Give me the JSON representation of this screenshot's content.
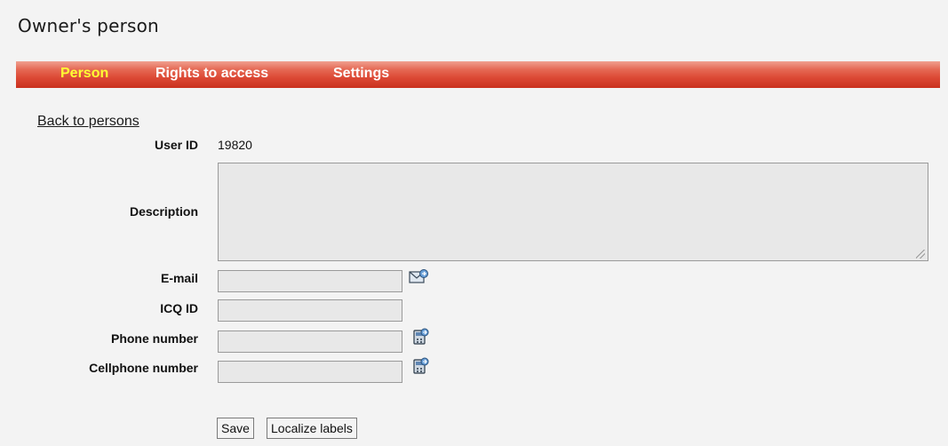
{
  "page": {
    "title": "Owner's person"
  },
  "tabs": [
    {
      "label": "Person",
      "active": true
    },
    {
      "label": "Rights to access",
      "active": false
    },
    {
      "label": "Settings",
      "active": false
    }
  ],
  "back_link": "Back to persons",
  "form": {
    "user_id": {
      "label": "User ID",
      "value": "19820"
    },
    "description": {
      "label": "Description",
      "value": ""
    },
    "email": {
      "label": "E-mail",
      "value": "",
      "icon": "email-send-icon"
    },
    "icq": {
      "label": "ICQ ID",
      "value": ""
    },
    "phone": {
      "label": "Phone number",
      "value": "",
      "icon": "phone-call-icon"
    },
    "cellphone": {
      "label": "Cellphone number",
      "value": "",
      "icon": "phone-call-icon"
    }
  },
  "buttons": {
    "save": "Save",
    "localize": "Localize labels"
  },
  "colors": {
    "tab_bar": "#dd4a36",
    "tab_active_text": "#ffff33",
    "tab_text": "#ffffff",
    "field_bg": "#e8e8e8",
    "page_bg": "#f3f3f3"
  }
}
